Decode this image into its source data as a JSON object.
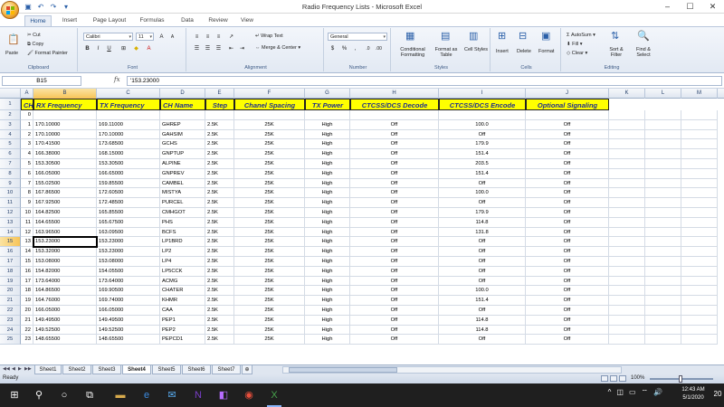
{
  "window": {
    "title": "Radio Frequency Lists  -  Microsoft Excel",
    "controls": [
      "–",
      "☐",
      "✕"
    ]
  },
  "tabs": [
    "Home",
    "Insert",
    "Page Layout",
    "Formulas",
    "Data",
    "Review",
    "View"
  ],
  "ribbon": {
    "clipboard": {
      "label": "Clipboard",
      "paste": "Paste",
      "cut": "Cut",
      "copy": "Copy",
      "format_painter": "Format Painter"
    },
    "font": {
      "label": "Font",
      "name": "Calibri",
      "size": "11",
      "bold": "B",
      "italic": "I",
      "underline": "U"
    },
    "alignment": {
      "label": "Alignment",
      "wrap_text": "Wrap Text",
      "merge_center": "Merge & Center"
    },
    "number": {
      "label": "Number",
      "format": "General",
      "currency": "$",
      "percent": "%",
      "comma": ","
    },
    "styles": {
      "label": "Styles",
      "conditional": "Conditional Formatting",
      "format_table": "Format as Table",
      "cell_styles": "Cell Styles"
    },
    "cells": {
      "label": "Cells",
      "insert": "Insert",
      "delete": "Delete",
      "format": "Format"
    },
    "editing": {
      "label": "Editing",
      "autosum": "AutoSum",
      "fill": "Fill",
      "clear": "Clear",
      "sort_filter": "Sort & Filter",
      "find_select": "Find & Select"
    }
  },
  "formula_bar": {
    "name_box": "B15",
    "fx": "fx",
    "formula": "'153.23000"
  },
  "columns": [
    "A",
    "B",
    "C",
    "D",
    "E",
    "F",
    "G",
    "H",
    "I",
    "J",
    "K",
    "L",
    "M"
  ],
  "headers": [
    "CH",
    "RX Frequency",
    "TX Frequency",
    "CH Name",
    "Step",
    "Chanel Spacing",
    "TX Power",
    "CTCSS/DCS Decode",
    "CTCSS/DCS Encode",
    "Optional Signaling"
  ],
  "rows": [
    [
      "0",
      "",
      "",
      "",
      "",
      "",
      "",
      "",
      "",
      ""
    ],
    [
      "1",
      "170.10000",
      "169.11000",
      "GHREP",
      "2.5K",
      "25K",
      "High",
      "Off",
      "100.0",
      "Off"
    ],
    [
      "2",
      "170.10000",
      "170.10000",
      "GAHSIM",
      "2.5K",
      "25K",
      "High",
      "Off",
      "Off",
      "Off"
    ],
    [
      "3",
      "170.41500",
      "173.68500",
      "GCHS",
      "2.5K",
      "25K",
      "High",
      "Off",
      "179.9",
      "Off"
    ],
    [
      "4",
      "166.38000",
      "168.15000",
      "GNPTUP",
      "2.5K",
      "25K",
      "High",
      "Off",
      "151.4",
      "Off"
    ],
    [
      "5",
      "153.30500",
      "153.30500",
      "ALPINE",
      "2.5K",
      "25K",
      "High",
      "Off",
      "203.5",
      "Off"
    ],
    [
      "6",
      "166.05000",
      "166.65000",
      "GNPREV",
      "2.5K",
      "25K",
      "High",
      "Off",
      "151.4",
      "Off"
    ],
    [
      "7",
      "155.02500",
      "159.85500",
      "CAMBEL",
      "2.5K",
      "25K",
      "High",
      "Off",
      "Off",
      "Off"
    ],
    [
      "8",
      "167.86500",
      "172.60500",
      "MISTYA",
      "2.5K",
      "25K",
      "High",
      "Off",
      "100.0",
      "Off"
    ],
    [
      "9",
      "167.92500",
      "172.48500",
      "PURCEL",
      "2.5K",
      "25K",
      "High",
      "Off",
      "Off",
      "Off"
    ],
    [
      "10",
      "164.82500",
      "165.85500",
      "CMHGOT",
      "2.5K",
      "25K",
      "High",
      "Off",
      "179.9",
      "Off"
    ],
    [
      "11",
      "164.65500",
      "165.67500",
      "PHS",
      "2.5K",
      "25K",
      "High",
      "Off",
      "114.8",
      "Off"
    ],
    [
      "12",
      "163.96500",
      "163.09500",
      "BCFS",
      "2.5K",
      "25K",
      "High",
      "Off",
      "131.8",
      "Off"
    ],
    [
      "13",
      "153.23000",
      "153.23000",
      "LP1BRD",
      "2.5K",
      "25K",
      "High",
      "Off",
      "Off",
      "Off"
    ],
    [
      "14",
      "153.32000",
      "153.23000",
      "LP2",
      "2.5K",
      "25K",
      "High",
      "Off",
      "Off",
      "Off"
    ],
    [
      "15",
      "153.08000",
      "153.08000",
      "LP4",
      "2.5K",
      "25K",
      "High",
      "Off",
      "Off",
      "Off"
    ],
    [
      "16",
      "154.82000",
      "154.05500",
      "LP5CCK",
      "2.5K",
      "25K",
      "High",
      "Off",
      "Off",
      "Off"
    ],
    [
      "17",
      "173.64000",
      "173.64000",
      "ACMG",
      "2.5K",
      "25K",
      "High",
      "Off",
      "Off",
      "Off"
    ],
    [
      "18",
      "164.86500",
      "169.90500",
      "CHATER",
      "2.5K",
      "25K",
      "High",
      "Off",
      "100.0",
      "Off"
    ],
    [
      "19",
      "164.76000",
      "169.74000",
      "KHMR",
      "2.5K",
      "25K",
      "High",
      "Off",
      "151.4",
      "Off"
    ],
    [
      "20",
      "166.05000",
      "166.05000",
      "CAA",
      "2.5K",
      "25K",
      "High",
      "Off",
      "Off",
      "Off"
    ],
    [
      "21",
      "149.49500",
      "149.49500",
      "PEP1",
      "2.5K",
      "25K",
      "High",
      "Off",
      "114.8",
      "Off"
    ],
    [
      "22",
      "149.52500",
      "149.52500",
      "PEP2",
      "2.5K",
      "25K",
      "High",
      "Off",
      "114.8",
      "Off"
    ],
    [
      "23",
      "148.65500",
      "148.65500",
      "PEPCD1",
      "2.5K",
      "25K",
      "High",
      "Off",
      "Off",
      "Off"
    ]
  ],
  "row_numbers": [
    "1",
    "2",
    "3",
    "4",
    "5",
    "6",
    "7",
    "8",
    "9",
    "10",
    "11",
    "12",
    "13",
    "14",
    "15",
    "16",
    "17",
    "18",
    "19",
    "20",
    "21",
    "22",
    "23",
    "24",
    "25"
  ],
  "selected": {
    "column": "B",
    "row": "15"
  },
  "sheets": [
    "Sheet1",
    "Sheet2",
    "Sheet3",
    "Sheet4",
    "Sheet5",
    "Sheet6",
    "Sheet7"
  ],
  "active_sheet": "Sheet4",
  "status": {
    "text": "Ready",
    "zoom": "100%"
  },
  "taskbar": {
    "time": "12:43 AM",
    "date": "5/1/2020",
    "notification_count": "20"
  }
}
